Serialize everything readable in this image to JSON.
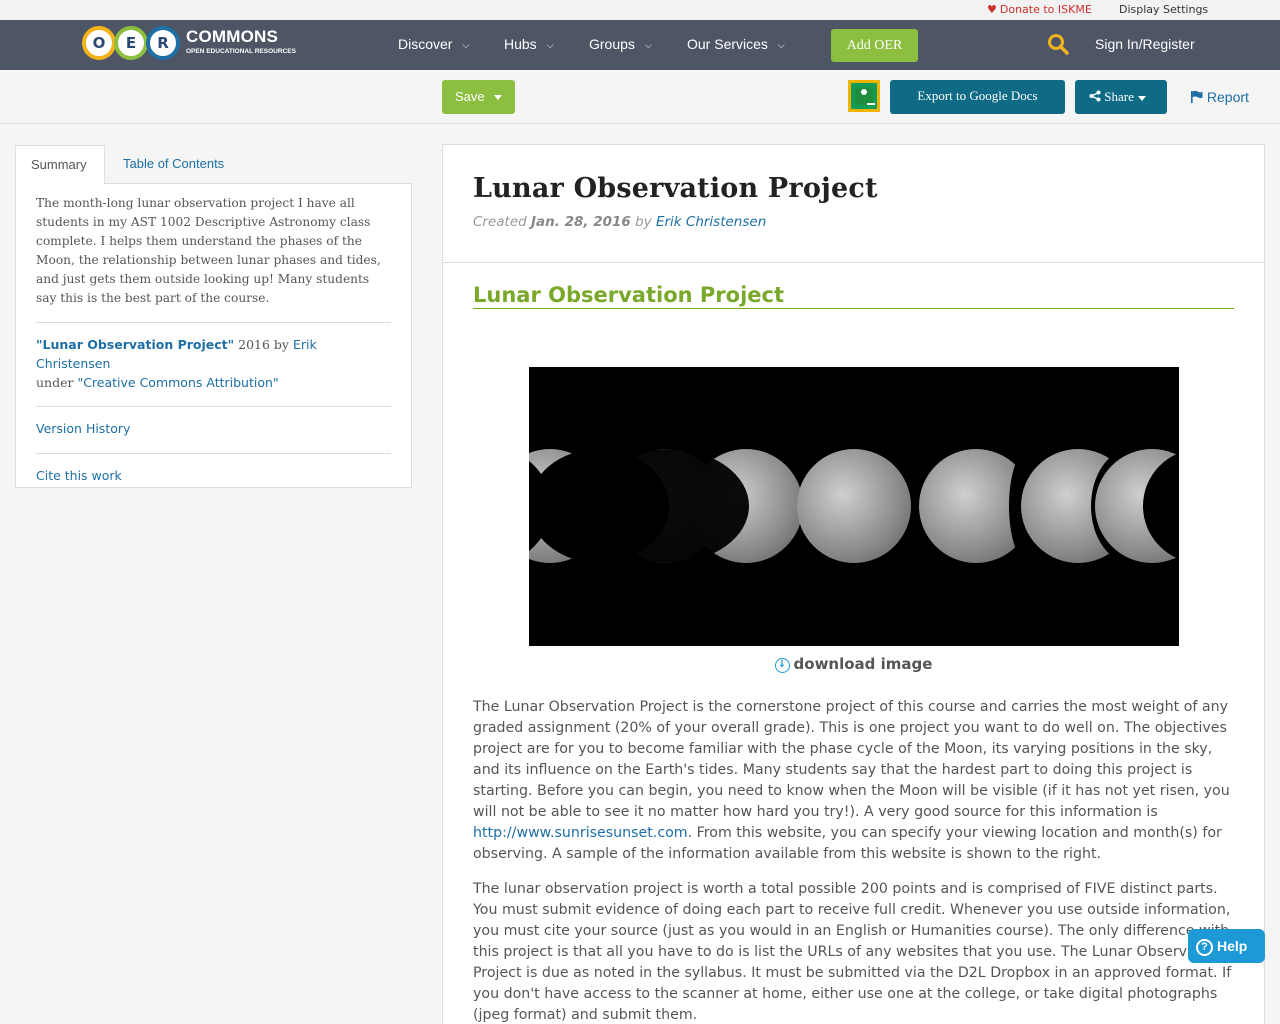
{
  "utility": {
    "donate": "Donate to ISKME",
    "display_settings": "Display Settings"
  },
  "logo": {
    "letters": [
      "O",
      "E",
      "R"
    ],
    "word": "COMMONS",
    "sub": "OPEN EDUCATIONAL RESOURCES"
  },
  "nav": {
    "items": [
      {
        "label": "Discover"
      },
      {
        "label": "Hubs"
      },
      {
        "label": "Groups"
      },
      {
        "label": "Our Services"
      }
    ],
    "add_oer": "Add OER",
    "signin": "Sign In/Register"
  },
  "toolbar": {
    "save": "Save",
    "export": "Export to Google Docs",
    "share": "Share",
    "report": "Report"
  },
  "sidebar": {
    "tabs": [
      "Summary",
      "Table of Contents"
    ],
    "summary": "The month-long lunar observation project I have all students in my AST 1002 Descriptive Astronomy class complete. I helps them understand the phases of the Moon, the relationship between lunar phases and tides, and just gets them outside looking up! Many students say this is the best part of the course.",
    "attribution": {
      "title": "\"Lunar Observation Project\"",
      "year": " 2016 by ",
      "author": "Erik Christensen",
      "under": "under ",
      "license": "\"Creative Commons Attribution\""
    },
    "version_history": "Version History",
    "cite": "Cite this work"
  },
  "main": {
    "title": "Lunar Observation Project",
    "created_label": "Created",
    "created_date": "Jan. 28, 2016",
    "by": "by",
    "author": "Erik Christensen",
    "section_title": "Lunar Observation Project",
    "download": "download image",
    "para1_a": "The Lunar Observation Project is the cornerstone project of this course and carries the most weight of any graded assignment (20% of your overall grade).  This is one project you want to do well on.  The objectives project are for you to become familiar with the phase cycle of the Moon, its varying positions in the sky, and its influence on the Earth's tides.  Many students say that the hardest part to doing this project is starting.  Before you can begin, you need to know when the Moon will be visible (if it has not yet risen, you will not be able to see it no matter how hard you try!).  A very good source for this information is ",
    "para1_link": "http://www.sunrisesunset.com",
    "para1_b": ".  From this website, you can specify your viewing location and month(s) for observing.  A sample of the information available from this website is shown to the right.",
    "para2": " The lunar observation project is worth a total possible 200 points and is comprised of FIVE distinct parts.  You must submit evidence of doing each part to receive full credit.  Whenever you use outside information, you must cite your source (just as you would in an English or Humanities course).  The only difference with this project is that all you have to do is list the URLs of any websites that you use.  The Lunar Observation Project is due as noted in the syllabus.  It must be submitted via the D2L Dropbox in an approved format.  If you don't have access to the scanner at home, either use one at the college, or take digital photographs (jpeg format) and submit them."
  },
  "help": "Help",
  "colors": {
    "nav_bg": "#4e5665",
    "green": "#8cbf3f",
    "teal": "#0f6a85",
    "link": "#1d6fa5",
    "help": "#1d9ad6"
  },
  "icons": [
    "heart-icon",
    "chevron-down-icon",
    "search-icon",
    "google-classroom-icon",
    "share-icon",
    "flag-icon",
    "download-icon",
    "question-icon"
  ]
}
